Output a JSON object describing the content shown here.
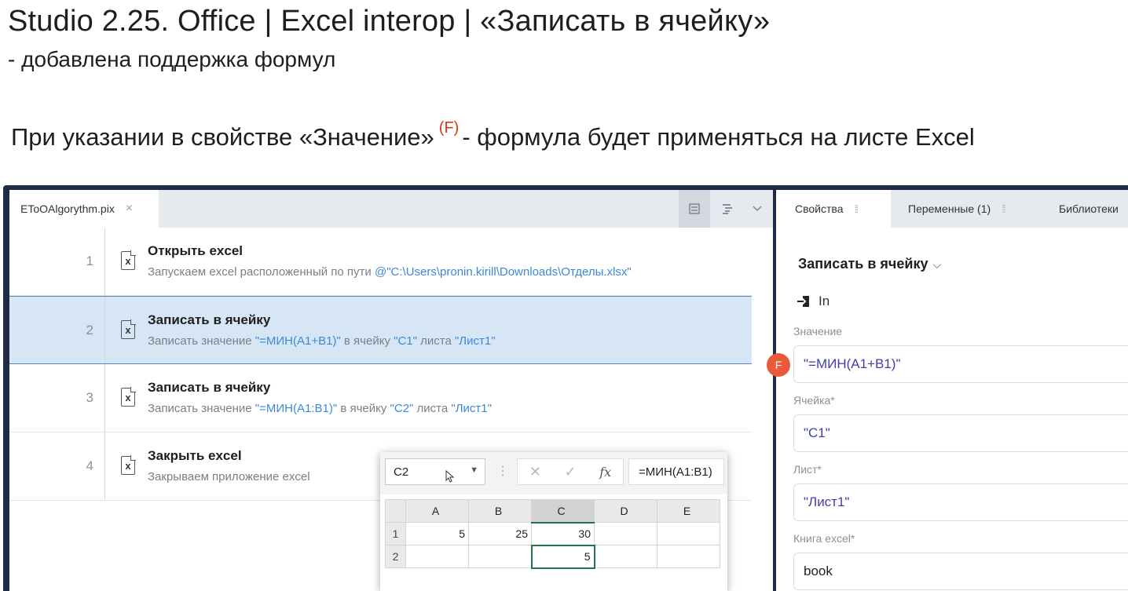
{
  "slide": {
    "title": "Studio 2.25. Office | Excel interop | «Записать в ячейку»",
    "subtitle": "- добавлена поддержка формул",
    "desc_before": "При указании в свойстве «Значение»",
    "desc_sup": "(F)",
    "desc_after": "- формула будет применяться на листе Excel"
  },
  "editor": {
    "file_tab": "EToOAlgorythm.pix",
    "close_icon": "×",
    "icons": [
      "list-view-icon",
      "outline-view-icon",
      "chevron-down-icon"
    ],
    "steps": [
      {
        "num": "1",
        "title": "Открыть excel",
        "desc_prefix": "Запускаем excel расположенный по пути ",
        "desc_hl1": "@\"C:\\Users\\pronin.kirill\\Downloads\\Отделы.xlsx\"",
        "desc_mid": "",
        "desc_hl2": "",
        "desc_mid2": "",
        "desc_hl3": ""
      },
      {
        "num": "2",
        "title": "Записать в ячейку",
        "desc_prefix": "Записать значение ",
        "desc_hl1": "\"=МИН(A1+B1)\"",
        "desc_mid": " в ячейку ",
        "desc_hl2": "\"C1\"",
        "desc_mid2": " листа ",
        "desc_hl3": "\"Лист1\""
      },
      {
        "num": "3",
        "title": "Записать в ячейку",
        "desc_prefix": "Записать значение ",
        "desc_hl1": "\"=МИН(A1:B1)\"",
        "desc_mid": " в ячейку ",
        "desc_hl2": "\"C2\"",
        "desc_mid2": " листа ",
        "desc_hl3": "\"Лист1\""
      },
      {
        "num": "4",
        "title": "Закрыть excel",
        "desc_prefix": "Закрываем приложение excel",
        "desc_hl1": "",
        "desc_mid": "",
        "desc_hl2": "",
        "desc_mid2": "",
        "desc_hl3": ""
      }
    ],
    "selected_step": "2"
  },
  "excel": {
    "namebox": "C2",
    "fx_label": "fx",
    "formula": "=МИН(A1:B1)",
    "columns": [
      "A",
      "B",
      "C",
      "D",
      "E"
    ],
    "rows": [
      {
        "label": "1",
        "cells": [
          "5",
          "25",
          "30",
          "",
          ""
        ]
      },
      {
        "label": "2",
        "cells": [
          "",
          "",
          "5",
          "",
          ""
        ]
      }
    ],
    "active_cell": "C2"
  },
  "panel": {
    "tabs": [
      "Свойства",
      "Переменные (1)",
      "Библиотеки"
    ],
    "title": "Записать в ячейку",
    "in_label": "In",
    "fields": [
      {
        "label": "Значение",
        "value": "\"=МИН(A1+B1)\""
      },
      {
        "label": "Ячейка*",
        "value": "\"C1\""
      },
      {
        "label": "Лист*",
        "value": "\"Лист1\""
      },
      {
        "label": "Книга excel*",
        "value": "book"
      }
    ],
    "formula_badge": "F"
  },
  "colors": {
    "accent_blue": "#3c88d8",
    "badge_red": "#ea5a3a",
    "excel_green": "#217346",
    "app_frame": "#1f2a44"
  }
}
